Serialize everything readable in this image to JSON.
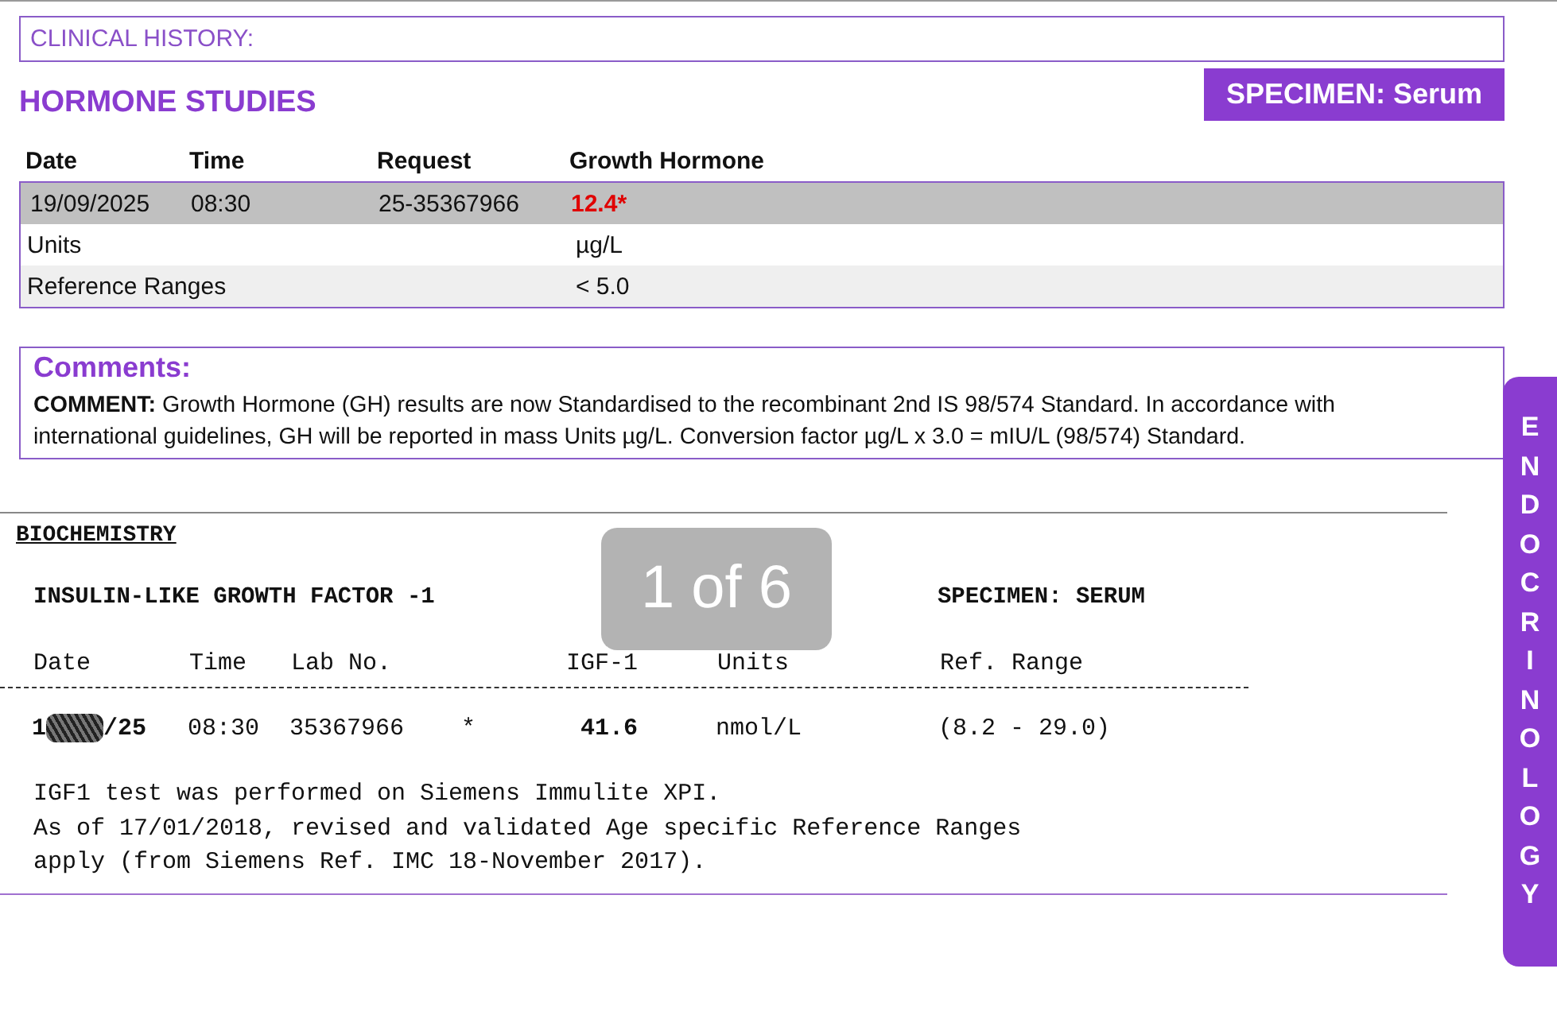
{
  "clinical_history": {
    "label": "CLINICAL HISTORY:"
  },
  "hormone_studies": {
    "title": "HORMONE STUDIES",
    "specimen": "SPECIMEN: Serum",
    "columns": [
      "Date",
      "Time",
      "Request",
      "Growth Hormone"
    ],
    "rows": [
      {
        "kind": "result",
        "cells": [
          "19/09/2025",
          "08:30",
          "25-35367966",
          "12.4*"
        ],
        "abnormal": true
      },
      {
        "kind": "info",
        "label": "Units",
        "value": "µg/L"
      },
      {
        "kind": "info",
        "label": "Reference Ranges",
        "value": "< 5.0"
      }
    ]
  },
  "comments": {
    "title": "Comments:",
    "text": "**COMMENT:** Growth Hormone (GH) results are now Standardised to the recombinant 2nd IS 98/574 Standard. In accordance with international guidelines, GH will be reported in mass Units µg/L. Conversion factor µg/L x 3.0 = mIU/L (98/574) Standard."
  },
  "biochemistry": {
    "section": "BIOCHEMISTRY",
    "test": "INSULIN-LIKE GROWTH FACTOR -1",
    "specimen": "SPECIMEN: SERUM",
    "columns": [
      "Date",
      "Time",
      "Lab No.",
      "IGF-1",
      "Units",
      "Ref. Range"
    ],
    "row": {
      "date_start": "1",
      "date_end": "/25",
      "date_redacted": true,
      "time": "08:30",
      "lab_no": "35367966",
      "flag": "*",
      "value": "41.6",
      "units": "nmol/L",
      "range": "(8.2 - 29.0)"
    },
    "notes": [
      "IGF1 test was performed on Siemens Immulite XPI.",
      "As of 17/01/2018, revised and validated Age specific Reference Ranges",
      "apply (from Siemens Ref. IMC 18-November 2017)."
    ]
  },
  "side_tab": {
    "label": "ENDOCRINOLOGY"
  },
  "page_indicator": "1 of 6"
}
